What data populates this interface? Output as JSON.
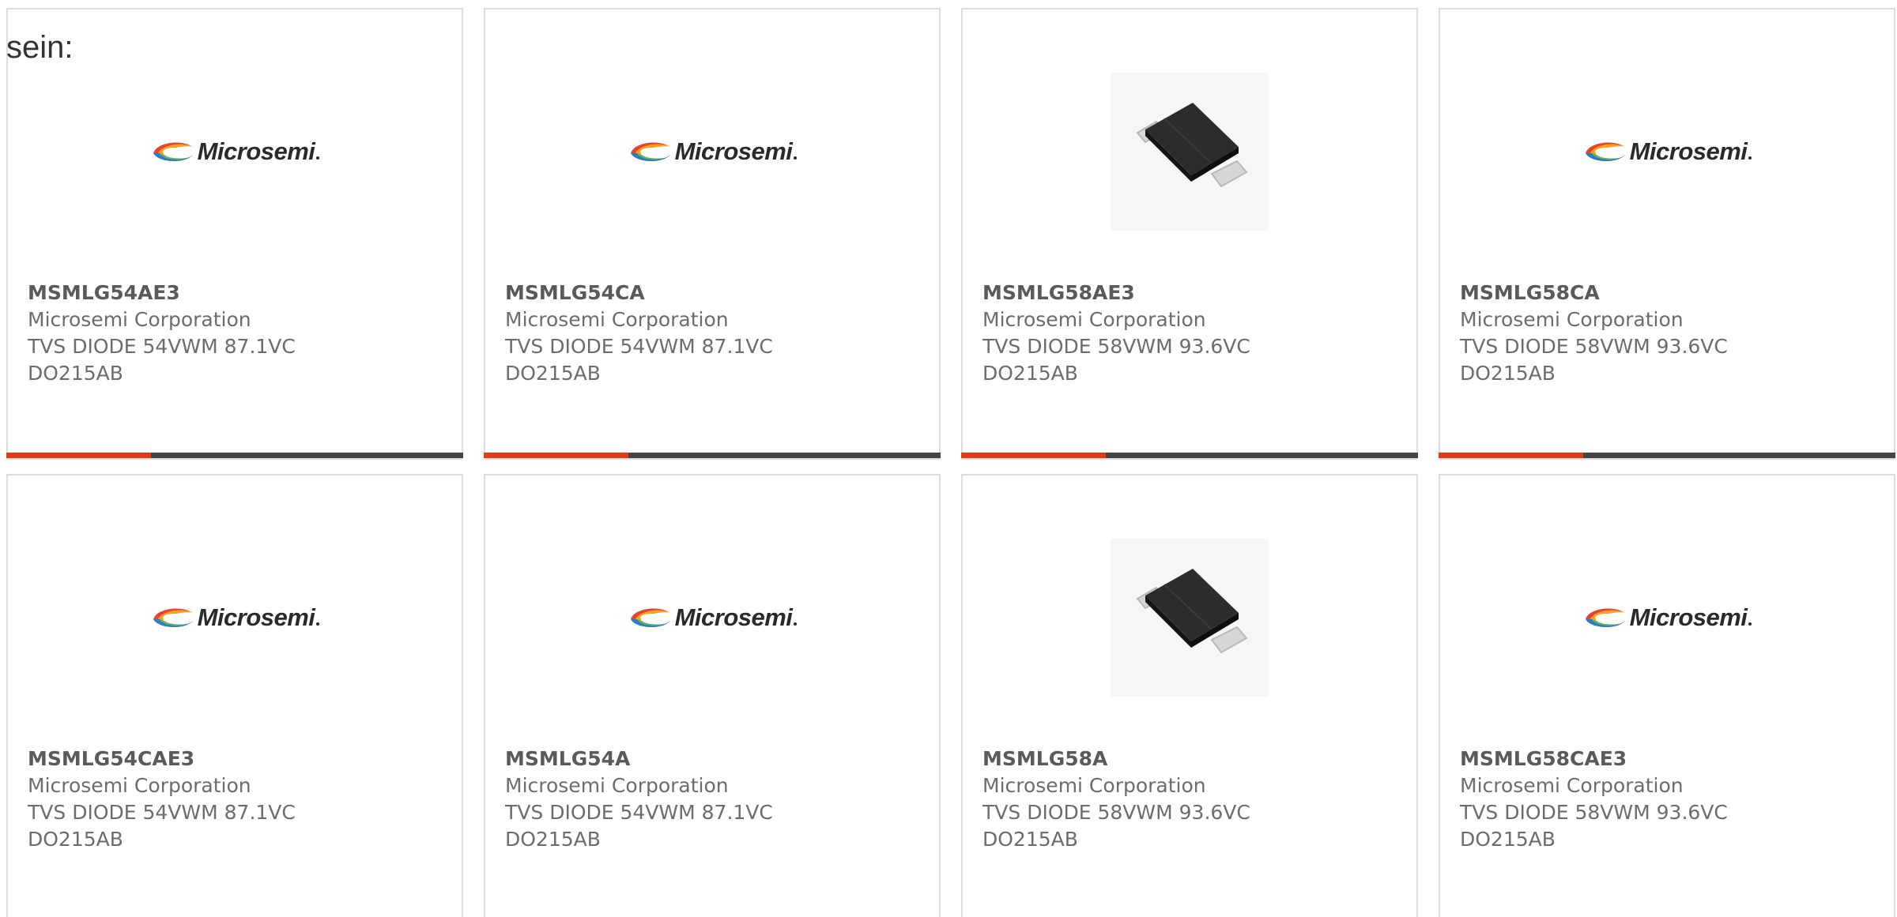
{
  "intro_text": "sein:",
  "logo_text": "Microsemi",
  "colors": {
    "accent": "#e43c12",
    "bar": "#444444",
    "text": "#6c6c6c",
    "border": "#dcdcdc"
  },
  "cards": [
    {
      "part": "MSMLG54AE3",
      "manufacturer": "Microsemi Corporation",
      "description": "TVS DIODE 54VWM 87.1VC",
      "package": "DO215AB",
      "image": "logo"
    },
    {
      "part": "MSMLG54CA",
      "manufacturer": "Microsemi Corporation",
      "description": "TVS DIODE 54VWM 87.1VC",
      "package": "DO215AB",
      "image": "logo"
    },
    {
      "part": "MSMLG58AE3",
      "manufacturer": "Microsemi Corporation",
      "description": "TVS DIODE 58VWM 93.6VC",
      "package": "DO215AB",
      "image": "photo"
    },
    {
      "part": "MSMLG58CA",
      "manufacturer": "Microsemi Corporation",
      "description": "TVS DIODE 58VWM 93.6VC",
      "package": "DO215AB",
      "image": "logo"
    },
    {
      "part": "MSMLG54CAE3",
      "manufacturer": "Microsemi Corporation",
      "description": "TVS DIODE 54VWM 87.1VC",
      "package": "DO215AB",
      "image": "logo"
    },
    {
      "part": "MSMLG54A",
      "manufacturer": "Microsemi Corporation",
      "description": "TVS DIODE 54VWM 87.1VC",
      "package": "DO215AB",
      "image": "logo"
    },
    {
      "part": "MSMLG58A",
      "manufacturer": "Microsemi Corporation",
      "description": "TVS DIODE 58VWM 93.6VC",
      "package": "DO215AB",
      "image": "photo"
    },
    {
      "part": "MSMLG58CAE3",
      "manufacturer": "Microsemi Corporation",
      "description": "TVS DIODE 58VWM 93.6VC",
      "package": "DO215AB",
      "image": "logo"
    }
  ]
}
